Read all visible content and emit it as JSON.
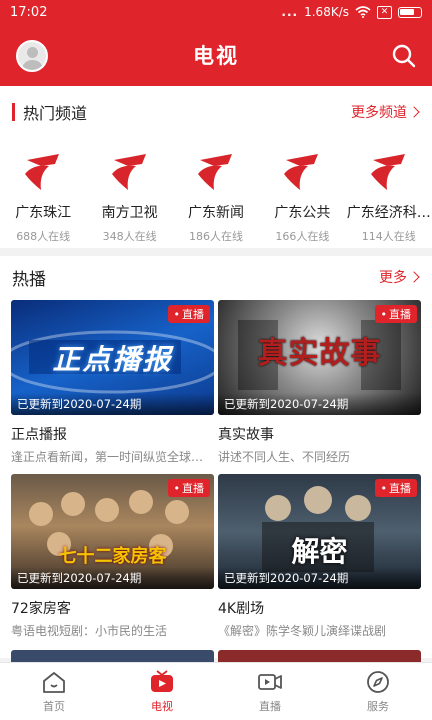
{
  "status_bar": {
    "time": "17:02",
    "signal": "...",
    "speed": "1.68K/s",
    "notif": "✕"
  },
  "header": {
    "title": "电视"
  },
  "hot_channels": {
    "title": "热门频道",
    "more": "更多频道",
    "items": [
      {
        "name": "广东珠江",
        "online": "688人在线"
      },
      {
        "name": "南方卫视",
        "online": "348人在线"
      },
      {
        "name": "广东新闻",
        "online": "186人在线"
      },
      {
        "name": "广东公共",
        "online": "166人在线"
      },
      {
        "name": "广东经济科…",
        "online": "114人在线"
      }
    ]
  },
  "hot_play": {
    "title": "热播",
    "more": "更多",
    "cards": [
      {
        "title": "正点播报",
        "subtitle": "逢正点看新闻，第一时间纵览全球…",
        "tag": "直播",
        "update": "已更新到2020-07-24期",
        "thumb_text": "正点播报"
      },
      {
        "title": "真实故事",
        "subtitle": "讲述不同人生、不同经历",
        "tag": "直播",
        "update": "已更新到2020-07-24期",
        "thumb_text": "真实故事"
      },
      {
        "title": "72家房客",
        "subtitle": "粤语电视短剧：小市民的生活",
        "tag": "直播",
        "update": "已更新到2020-07-24期",
        "thumb_text": "七十二家房客"
      },
      {
        "title": "4K剧场",
        "subtitle": "《解密》陈学冬颖儿演绎谍战剧",
        "tag": "直播",
        "update": "已更新到2020-07-24期",
        "thumb_text": "解密"
      }
    ]
  },
  "tabbar": {
    "items": [
      {
        "label": "首页",
        "icon": "home-icon"
      },
      {
        "label": "电视",
        "icon": "tv-icon"
      },
      {
        "label": "直播",
        "icon": "video-icon"
      },
      {
        "label": "服务",
        "icon": "compass-icon"
      }
    ]
  },
  "colors": {
    "accent": "#e0242b",
    "muted": "#888888"
  }
}
